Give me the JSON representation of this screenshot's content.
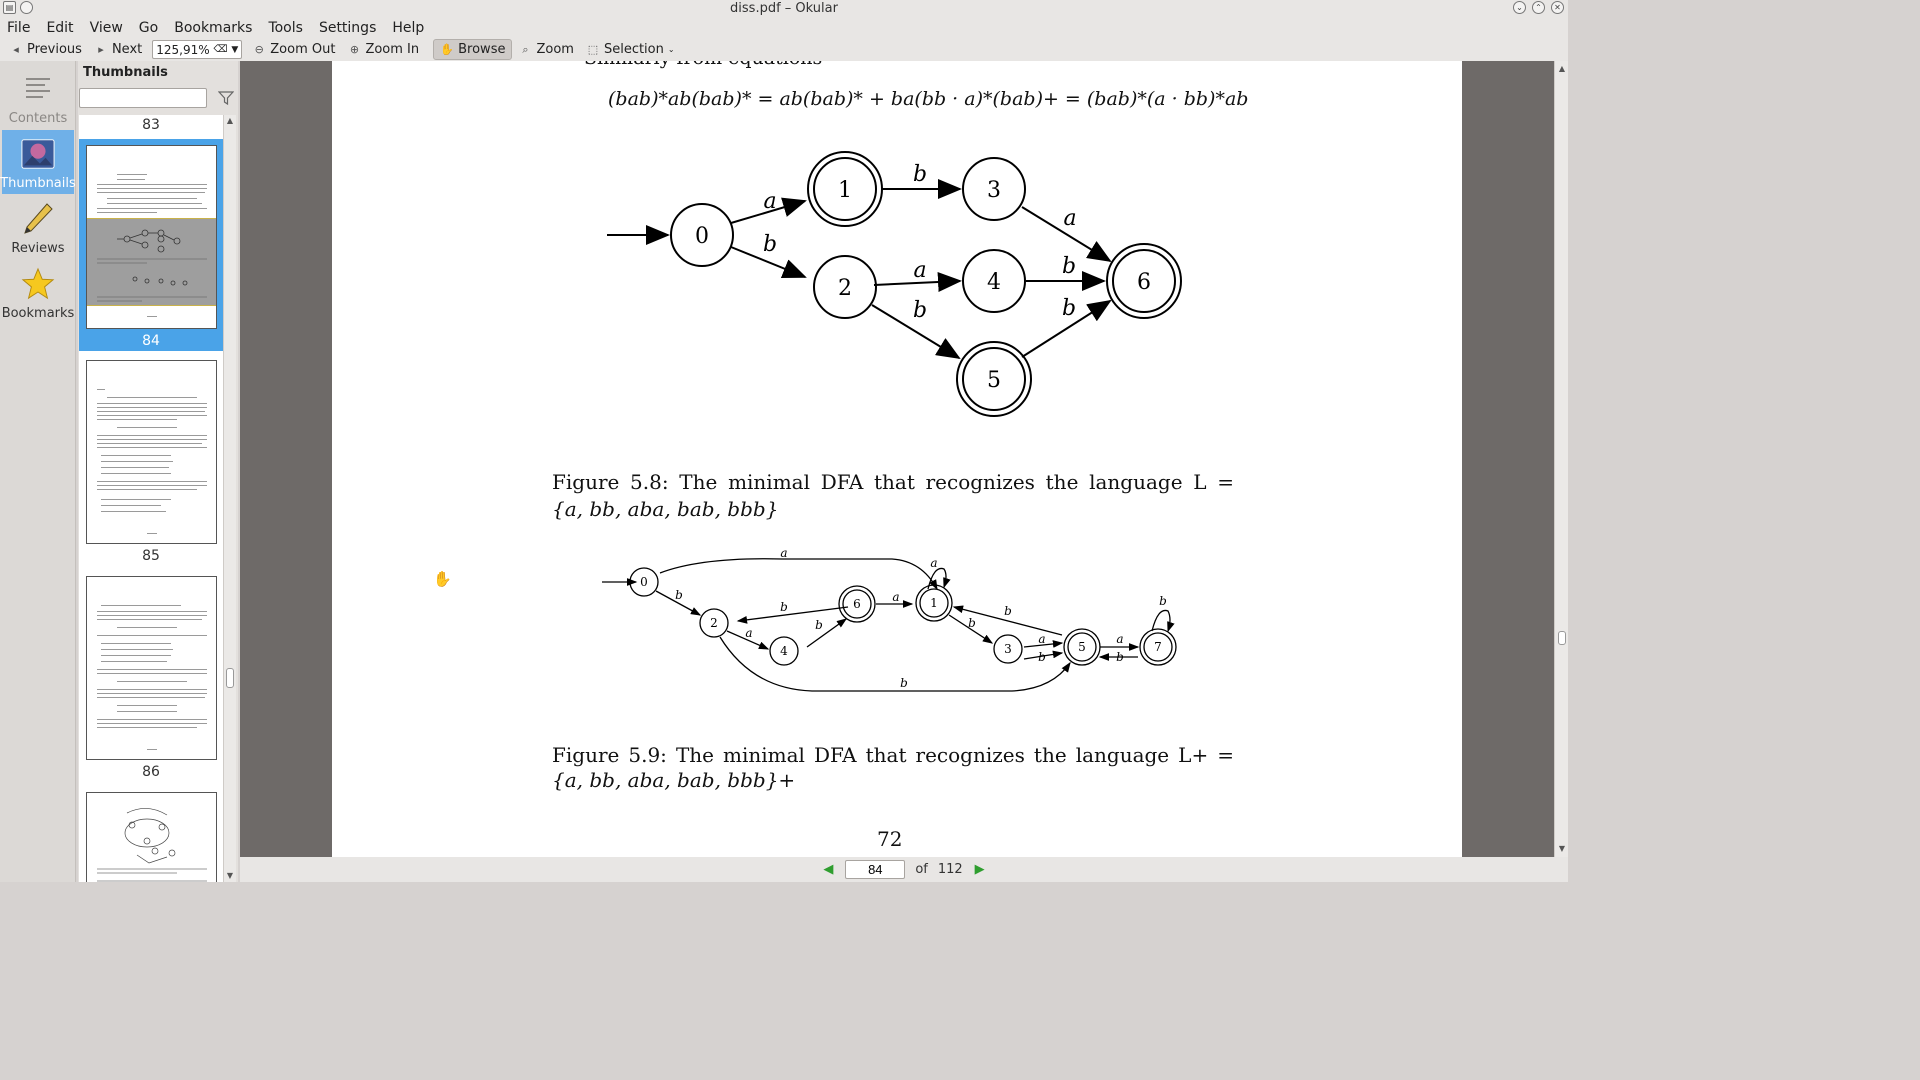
{
  "window": {
    "title": "diss.pdf – Okular"
  },
  "menu": [
    "File",
    "Edit",
    "View",
    "Go",
    "Bookmarks",
    "Tools",
    "Settings",
    "Help"
  ],
  "toolbar": {
    "previous": "Previous",
    "next": "Next",
    "zoom_value": "125,91%",
    "zoom_out": "Zoom Out",
    "zoom_in": "Zoom In",
    "browse": "Browse",
    "zoom": "Zoom",
    "selection": "Selection"
  },
  "sidebar": {
    "items": [
      {
        "label": "Contents",
        "icon": "contents-icon"
      },
      {
        "label": "Thumbnails",
        "icon": "thumbnails-icon"
      },
      {
        "label": "Reviews",
        "icon": "pencil-icon"
      },
      {
        "label": "Bookmarks",
        "icon": "star-icon"
      }
    ]
  },
  "thumbnails": {
    "header": "Thumbnails",
    "search_value": "",
    "pages": [
      "83",
      "84",
      "85",
      "86"
    ],
    "selected_page": "84"
  },
  "document": {
    "partial_top_text": "Similarly from equations",
    "equation": "(bab)*ab(bab)* = ab(bab)* + ba(bb · a)*(bab)+ = (bab)*(a · bb)*ab",
    "fig1": {
      "nodes": [
        "0",
        "1",
        "2",
        "3",
        "4",
        "5",
        "6"
      ],
      "edge_labels": [
        "a",
        "b",
        "b",
        "a",
        "a",
        "b",
        "b",
        "b"
      ],
      "caption_line1": "Figure 5.8:  The minimal DFA that recognizes the language L =",
      "caption_line2": "{a, bb, aba, bab, bbb}"
    },
    "fig2": {
      "nodes": [
        "0",
        "1",
        "2",
        "3",
        "4",
        "5",
        "6",
        "7"
      ],
      "edge_labels": [
        "a",
        "a",
        "b",
        "b",
        "a",
        "b",
        "a",
        "b",
        "b",
        "a",
        "b",
        "a",
        "b",
        "b"
      ],
      "caption_line1": "Figure 5.9:  The minimal DFA that recognizes the language L+ =",
      "caption_line2": "{a, bb, aba, bab, bbb}+"
    },
    "page_number": "72"
  },
  "pagebar": {
    "current": "84",
    "of_label": "of",
    "total": "112"
  }
}
